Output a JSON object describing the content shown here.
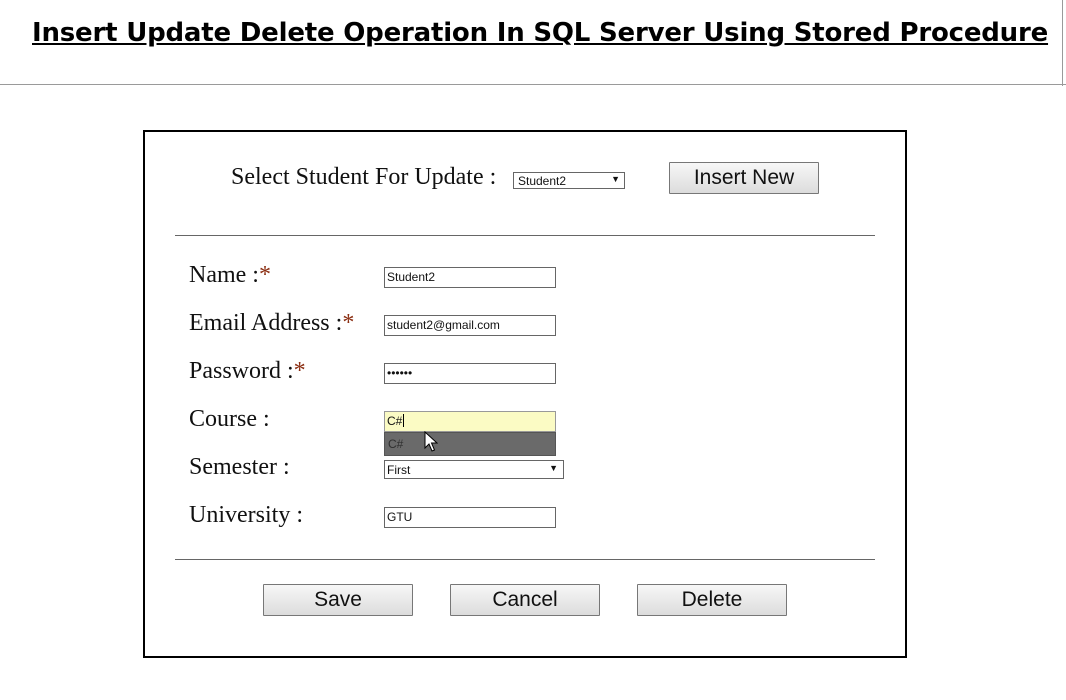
{
  "page": {
    "title": "Insert Update Delete Operation In SQL Server Using Stored Procedure"
  },
  "selector": {
    "label": "Select Student For Update :",
    "value": "Student2",
    "insert_label": "Insert New"
  },
  "form": {
    "name": {
      "label": "Name :",
      "required_mark": "*",
      "value": "Student2"
    },
    "email": {
      "label": "Email Address :",
      "required_mark": "*",
      "value": "student2@gmail.com"
    },
    "password": {
      "label": "Password :",
      "required_mark": "*",
      "value": "••••••"
    },
    "course": {
      "label": "Course :",
      "value": "C#",
      "suggestion": "C#"
    },
    "semester": {
      "label": "Semester :",
      "value": "First"
    },
    "university": {
      "label": "University :",
      "value": "GTU"
    }
  },
  "actions": {
    "save_label": "Save",
    "cancel_label": "Cancel",
    "delete_label": "Delete"
  },
  "colors": {
    "required_mark": "#8b2e12",
    "focused_field_bg": "#fbfbc4",
    "autocomplete_bg": "#6a6a6a"
  }
}
